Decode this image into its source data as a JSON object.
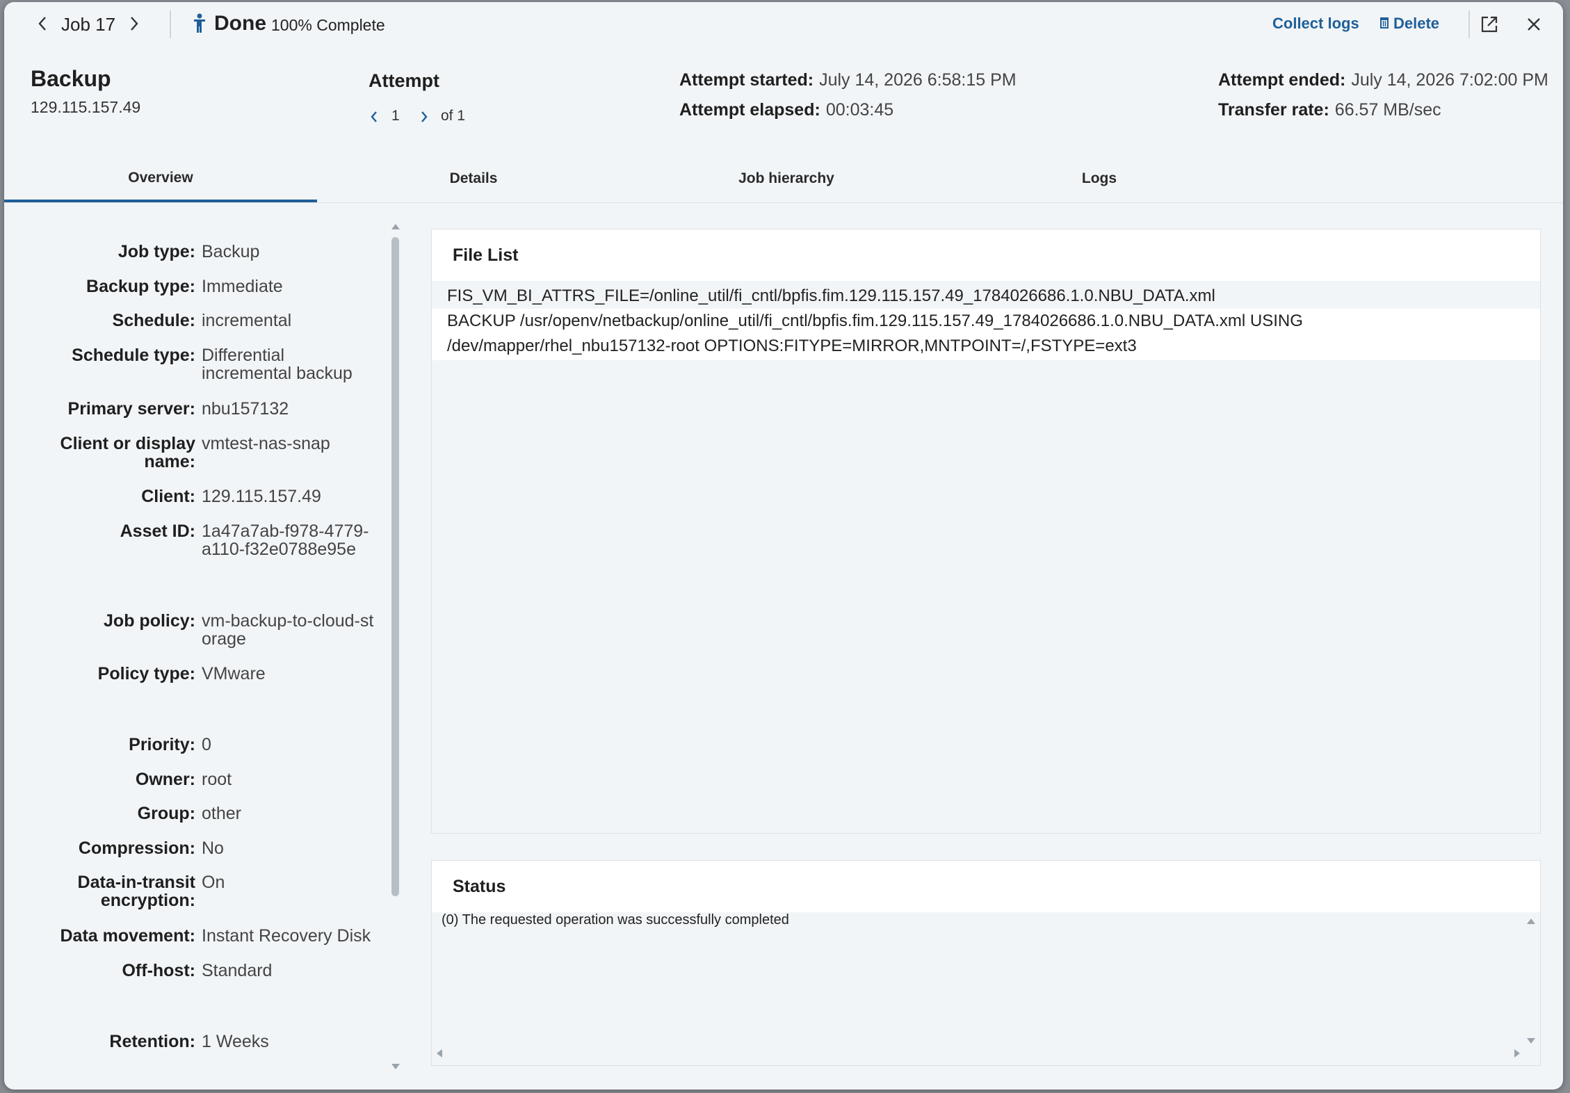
{
  "topbar": {
    "job_label": "Job 17",
    "status_label": "Done",
    "percent_label": "100% Complete",
    "collect_logs": "Collect logs",
    "delete": "Delete"
  },
  "header": {
    "title": "Backup",
    "ip": "129.115.157.49",
    "attempt_title": "Attempt",
    "attempt_current": "1",
    "attempt_of": "of 1",
    "started_label": "Attempt started:",
    "started_value": "July 14, 2026 6:58:15 PM",
    "elapsed_label": "Attempt elapsed:",
    "elapsed_value": "00:03:45",
    "ended_label": "Attempt ended:",
    "ended_value": "July 14, 2026 7:02:00 PM",
    "rate_label": "Transfer rate:",
    "rate_value": "66.57 MB/sec"
  },
  "tabs": [
    "Overview",
    "Details",
    "Job hierarchy",
    "Logs"
  ],
  "properties": [
    {
      "label": "Job type:",
      "value": "Backup"
    },
    {
      "label": "Backup type:",
      "value": "Immediate"
    },
    {
      "label": "Schedule:",
      "value": "incremental"
    },
    {
      "label": "Schedule type:",
      "value": "Differential incremental backup"
    },
    {
      "label": "Primary server:",
      "value": "nbu157132"
    },
    {
      "label": "Client or display name:",
      "value": "vmtest-nas-snap"
    },
    {
      "label": "Client:",
      "value": "129.115.157.49"
    },
    {
      "label": "Asset ID:",
      "value": "1a47a7ab-f978-4779-a110-f32e0788e95e"
    },
    {
      "label": "Job policy:",
      "value": "vm-backup-to-cloud-storage"
    },
    {
      "label": "Policy type:",
      "value": "VMware"
    },
    {
      "label": "Priority:",
      "value": "0"
    },
    {
      "label": "Owner:",
      "value": "root"
    },
    {
      "label": "Group:",
      "value": "other"
    },
    {
      "label": "Compression:",
      "value": "No"
    },
    {
      "label": "Data-in-transit encryption:",
      "value": "On"
    },
    {
      "label": "Data movement:",
      "value": "Instant Recovery Disk"
    },
    {
      "label": "Off-host:",
      "value": "Standard"
    },
    {
      "label": "Retention:",
      "value": "1 Weeks"
    }
  ],
  "file_list": {
    "title": "File List",
    "rows": [
      "FIS_VM_BI_ATTRS_FILE=/online_util/fi_cntl/bpfis.fim.129.115.157.49_1784026686.1.0.NBU_DATA.xml",
      "BACKUP /usr/openv/netbackup/online_util/fi_cntl/bpfis.fim.129.115.157.49_1784026686.1.0.NBU_DATA.xml USING",
      "/dev/mapper/rhel_nbu157132-root OPTIONS:FITYPE=MIRROR,MNTPOINT=/,FSTYPE=ext3"
    ]
  },
  "status": {
    "title": "Status",
    "message": "(0) The requested operation was successfully completed"
  },
  "colors": {
    "accent": "#1f5f99",
    "background": "#f2f5f7",
    "panel_header": "#ffffff"
  }
}
